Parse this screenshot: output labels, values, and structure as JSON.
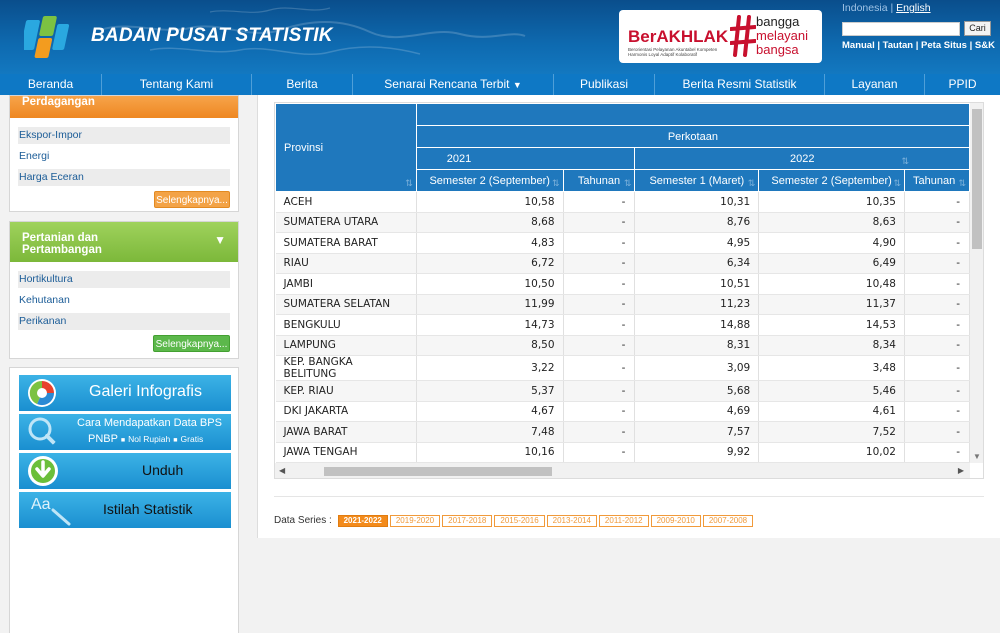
{
  "header": {
    "brand": "BADAN PUSAT STATISTIK",
    "berakhlak_title": "BerAKHLAK",
    "berakhlak_sub": "Berorientasi Pelayanan Akuntabel Kompeten Harmonis Loyal Adaptif Kolaboratif",
    "bangga_1": "bangga",
    "bangga_2": "melayani",
    "bangga_3": "bangsa",
    "lang_id": "Indonesia",
    "lang_sep": " | ",
    "lang_en": "English",
    "search_button": "Cari",
    "toplinks": "Manual | Tautan | Peta Situs | S&K"
  },
  "nav": [
    {
      "label": "Beranda"
    },
    {
      "label": "Tentang Kami"
    },
    {
      "label": "Berita"
    },
    {
      "label": "Senarai Rencana Terbit",
      "caret": "▼"
    },
    {
      "label": "Publikasi"
    },
    {
      "label": "Berita Resmi Statistik"
    },
    {
      "label": "Layanan"
    },
    {
      "label": "PPID"
    }
  ],
  "sidebar": {
    "trade_panel": {
      "title": "Perdagangan",
      "items": [
        "Ekspor-Impor",
        "Energi",
        "Harga Eceran"
      ],
      "more": "Selengkapnya..."
    },
    "agri_panel": {
      "title_1": "Pertanian dan",
      "title_2": "Pertambangan",
      "toggle": "▼",
      "items": [
        "Hortikultura",
        "Kehutanan",
        "Perikanan"
      ],
      "more": "Selengkapnya..."
    },
    "banners": {
      "infografis": "Galeri Infografis",
      "cara_1": "Cara Mendapatkan Data BPS",
      "cara_2": "PNBP",
      "cara_3": "Nol Rupiah",
      "cara_4": "Gratis",
      "unduh": "Unduh",
      "istilah": "Istilah Statistik",
      "aa": "Aa"
    }
  },
  "table": {
    "col_provinsi": "Provinsi",
    "group": "Perkotaan",
    "year_2021": "2021",
    "year_2022": "2022",
    "sub_cols": [
      "Semester 2 (September)",
      "Tahunan",
      "Semester 1 (Maret)",
      "Semester 2 (September)",
      "Tahunan"
    ],
    "rows": [
      {
        "prov": "ACEH",
        "v": [
          "10,58",
          "-",
          "10,31",
          "10,35",
          "-"
        ]
      },
      {
        "prov": "SUMATERA UTARA",
        "v": [
          "8,68",
          "-",
          "8,76",
          "8,63",
          "-"
        ]
      },
      {
        "prov": "SUMATERA BARAT",
        "v": [
          "4,83",
          "-",
          "4,95",
          "4,90",
          "-"
        ]
      },
      {
        "prov": "RIAU",
        "v": [
          "6,72",
          "-",
          "6,34",
          "6,49",
          "-"
        ]
      },
      {
        "prov": "JAMBI",
        "v": [
          "10,50",
          "-",
          "10,51",
          "10,48",
          "-"
        ]
      },
      {
        "prov": "SUMATERA SELATAN",
        "v": [
          "11,99",
          "-",
          "11,23",
          "11,37",
          "-"
        ]
      },
      {
        "prov": "BENGKULU",
        "v": [
          "14,73",
          "-",
          "14,88",
          "14,53",
          "-"
        ]
      },
      {
        "prov": "LAMPUNG",
        "v": [
          "8,50",
          "-",
          "8,31",
          "8,34",
          "-"
        ]
      },
      {
        "prov": "KEP. BANGKA BELITUNG",
        "v": [
          "3,22",
          "-",
          "3,09",
          "3,48",
          "-"
        ]
      },
      {
        "prov": "KEP. RIAU",
        "v": [
          "5,37",
          "-",
          "5,68",
          "5,46",
          "-"
        ]
      },
      {
        "prov": "DKI JAKARTA",
        "v": [
          "4,67",
          "-",
          "4,69",
          "4,61",
          "-"
        ]
      },
      {
        "prov": "JAWA BARAT",
        "v": [
          "7,48",
          "-",
          "7,57",
          "7,52",
          "-"
        ]
      },
      {
        "prov": "JAWA TENGAH",
        "v": [
          "10,16",
          "-",
          "9,92",
          "10,02",
          "-"
        ]
      }
    ]
  },
  "data_series": {
    "label": "Data Series :",
    "options": [
      "2021-2022",
      "2019-2020",
      "2017-2018",
      "2015-2016",
      "2013-2014",
      "2011-2012",
      "2009-2010",
      "2007-2008"
    ],
    "active": "2021-2022"
  },
  "colors": {
    "header": "#0e6ab0",
    "nav": "#0e78c5",
    "table_header": "#1f78bd",
    "orange": "#ee8722",
    "green": "#7cb83a",
    "berakhlak_red": "#c8102e"
  }
}
